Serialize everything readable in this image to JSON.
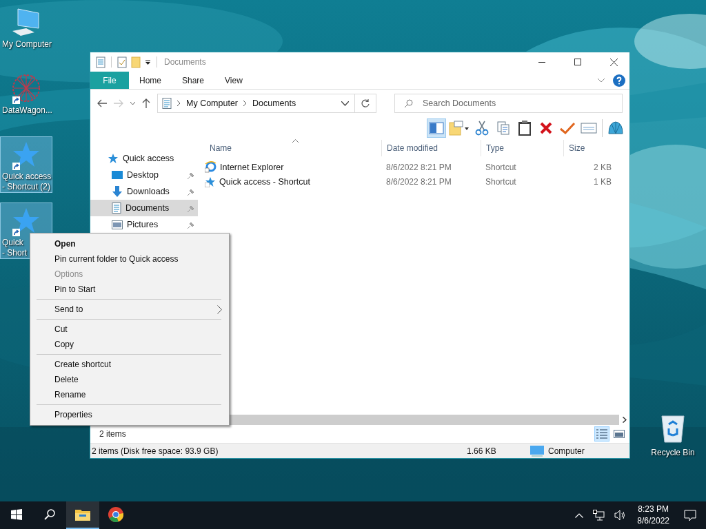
{
  "desktop": {
    "icons": [
      {
        "kind": "computer",
        "lines": [
          "My Computer"
        ],
        "selected": false,
        "shortcut": false
      },
      {
        "kind": "mesh",
        "lines": [
          "DataWagon..."
        ],
        "selected": false,
        "shortcut": true
      },
      {
        "kind": "star",
        "lines": [
          "Quick access",
          "- Shortcut (2)"
        ],
        "selected": true,
        "shortcut": true
      },
      {
        "kind": "star",
        "lines": [
          "Quick",
          "- Short"
        ],
        "selected": true,
        "shortcut": true
      }
    ],
    "recycle_bin": {
      "kind": "recycle",
      "label": "Recycle Bin"
    }
  },
  "window": {
    "title": "Documents",
    "quick_toolbar": [
      {
        "kind": "properties"
      },
      {
        "kind": "check"
      },
      {
        "kind": "folder"
      },
      {
        "kind": "dropdown"
      }
    ],
    "ribbon_tabs": [
      {
        "label": "File",
        "selected": true
      },
      {
        "label": "Home",
        "selected": false
      },
      {
        "label": "Share",
        "selected": false
      },
      {
        "label": "View",
        "selected": false
      }
    ],
    "address": {
      "path": [
        "My Computer",
        "Documents"
      ]
    },
    "search": {
      "placeholder": "Search Documents"
    },
    "toolbar": [
      {
        "kind": "pane",
        "selected": true
      },
      {
        "kind": "newfolder",
        "selected": false
      },
      {
        "kind": "cut",
        "selected": false
      },
      {
        "kind": "copy",
        "selected": false
      },
      {
        "kind": "paste",
        "selected": false
      },
      {
        "kind": "delete",
        "selected": false
      },
      {
        "kind": "check",
        "selected": false
      },
      {
        "kind": "rename",
        "selected": false
      },
      {
        "kind": "shell",
        "selected": false
      }
    ],
    "nav": [
      {
        "label": "Quick access",
        "kind": "star",
        "selected": false,
        "children": [
          {
            "label": "Desktop",
            "kind": "desktop",
            "selected": false,
            "pinned": true
          },
          {
            "label": "Downloads",
            "kind": "downloads",
            "selected": false,
            "pinned": true
          },
          {
            "label": "Documents",
            "kind": "documents",
            "selected": true,
            "pinned": true
          },
          {
            "label": "Pictures",
            "kind": "pictures",
            "selected": false,
            "pinned": true
          }
        ]
      }
    ],
    "columns": [
      "Name",
      "Date modified",
      "Type",
      "Size"
    ],
    "files": [
      {
        "kind": "ie",
        "name": "Internet Explorer",
        "date": "8/6/2022 8:21 PM",
        "type": "Shortcut",
        "size": "2 KB",
        "selected": false
      },
      {
        "kind": "star",
        "name": "Quick access - Shortcut",
        "date": "8/6/2022 8:21 PM",
        "type": "Shortcut",
        "size": "1 KB",
        "selected": false
      }
    ],
    "item_count": "2 items",
    "views": [
      {
        "kind": "details",
        "selected": true
      },
      {
        "kind": "large",
        "selected": false
      }
    ],
    "status_bar": {
      "summary": "2 items (Disk free space: 93.9 GB)",
      "size": "1.66 KB",
      "location": "Computer"
    }
  },
  "context_menu": [
    {
      "kind": "item",
      "label": "Open",
      "default": true,
      "disabled": false
    },
    {
      "kind": "item",
      "label": "Pin current folder to Quick access",
      "default": false,
      "disabled": false
    },
    {
      "kind": "item",
      "label": "Options",
      "default": false,
      "disabled": true
    },
    {
      "kind": "item",
      "label": "Pin to Start",
      "default": false,
      "disabled": false
    },
    {
      "kind": "separator"
    },
    {
      "kind": "submenu",
      "label": "Send to",
      "default": false,
      "disabled": false
    },
    {
      "kind": "separator"
    },
    {
      "kind": "item",
      "label": "Cut",
      "default": false,
      "disabled": false
    },
    {
      "kind": "item",
      "label": "Copy",
      "default": false,
      "disabled": false
    },
    {
      "kind": "separator"
    },
    {
      "kind": "item",
      "label": "Create shortcut",
      "default": false,
      "disabled": false
    },
    {
      "kind": "item",
      "label": "Delete",
      "default": false,
      "disabled": false
    },
    {
      "kind": "item",
      "label": "Rename",
      "default": false,
      "disabled": false
    },
    {
      "kind": "separator"
    },
    {
      "kind": "item",
      "label": "Properties",
      "default": false,
      "disabled": false
    }
  ],
  "taskbar": {
    "apps": [
      {
        "kind": "start",
        "active": false
      },
      {
        "kind": "search",
        "active": false
      },
      {
        "kind": "explorer",
        "active": true
      },
      {
        "kind": "browser",
        "active": false
      }
    ],
    "clock": {
      "time": "8:23 PM",
      "date": "8/6/2022"
    }
  }
}
